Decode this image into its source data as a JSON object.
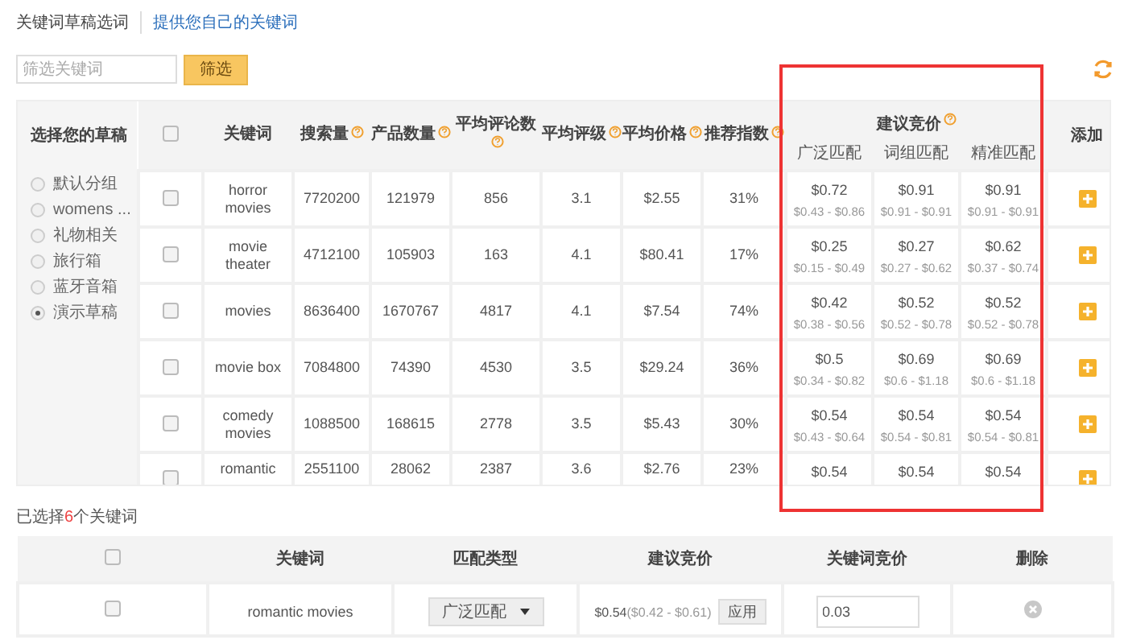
{
  "tabs": [
    {
      "label": "关键词草稿选词",
      "selected": true
    },
    {
      "label": "提供您自己的关键词",
      "selected": false
    }
  ],
  "filter": {
    "placeholder": "筛选关键词",
    "button": "筛选"
  },
  "drafts": {
    "title": "选择您的草稿",
    "items": [
      {
        "label": "默认分组",
        "selected": false
      },
      {
        "label": "womens ...",
        "selected": false
      },
      {
        "label": "礼物相关",
        "selected": false
      },
      {
        "label": "旅行箱",
        "selected": false
      },
      {
        "label": "蓝牙音箱",
        "selected": false
      },
      {
        "label": "演示草稿",
        "selected": true
      }
    ]
  },
  "keyword_table": {
    "select_all": false,
    "columns": [
      {
        "label": "关键词",
        "help": false
      },
      {
        "label": "搜索量",
        "help": true
      },
      {
        "label": "产品数量",
        "help": true
      },
      {
        "label": "平均评论数",
        "help": true
      },
      {
        "label": "平均评级",
        "help": true
      },
      {
        "label": "平均价格",
        "help": true
      },
      {
        "label": "推荐指数",
        "help": true
      }
    ],
    "bid_group": {
      "label": "建议竞价",
      "help": true,
      "columns": [
        "广泛匹配",
        "词组匹配",
        "精准匹配"
      ]
    },
    "add_column": "添加",
    "rows": [
      {
        "checked": false,
        "cells": [
          "horror movies",
          "7720200",
          "121979",
          "856",
          "3.1",
          "$2.55",
          "31%"
        ],
        "bids": [
          {
            "bid": "$0.72",
            "range": "$0.43 - $0.86"
          },
          {
            "bid": "$0.91",
            "range": "$0.91 - $0.91"
          },
          {
            "bid": "$0.91",
            "range": "$0.91 - $0.91"
          }
        ]
      },
      {
        "checked": false,
        "cells": [
          "movie theater",
          "4712100",
          "105903",
          "163",
          "4.1",
          "$80.41",
          "17%"
        ],
        "bids": [
          {
            "bid": "$0.25",
            "range": "$0.15 - $0.49"
          },
          {
            "bid": "$0.27",
            "range": "$0.27 - $0.62"
          },
          {
            "bid": "$0.62",
            "range": "$0.37 - $0.74"
          }
        ]
      },
      {
        "checked": false,
        "cells": [
          "movies",
          "8636400",
          "1670767",
          "4817",
          "4.1",
          "$7.54",
          "74%"
        ],
        "bids": [
          {
            "bid": "$0.42",
            "range": "$0.38 - $0.56"
          },
          {
            "bid": "$0.52",
            "range": "$0.52 - $0.78"
          },
          {
            "bid": "$0.52",
            "range": "$0.52 - $0.78"
          }
        ]
      },
      {
        "checked": false,
        "cells": [
          "movie box",
          "7084800",
          "74390",
          "4530",
          "3.5",
          "$29.24",
          "36%"
        ],
        "bids": [
          {
            "bid": "$0.5",
            "range": "$0.34 - $0.82"
          },
          {
            "bid": "$0.69",
            "range": "$0.6 - $1.18"
          },
          {
            "bid": "$0.69",
            "range": "$0.6 - $1.18"
          }
        ]
      },
      {
        "checked": false,
        "cells": [
          "comedy movies",
          "1088500",
          "168615",
          "2778",
          "3.5",
          "$5.43",
          "30%"
        ],
        "bids": [
          {
            "bid": "$0.54",
            "range": "$0.43 - $0.64"
          },
          {
            "bid": "$0.54",
            "range": "$0.54 - $0.81"
          },
          {
            "bid": "$0.54",
            "range": "$0.54 - $0.81"
          }
        ]
      },
      {
        "checked": false,
        "cells": [
          "romantic",
          "2551100",
          "28062",
          "2387",
          "3.6",
          "$2.76",
          "23%"
        ],
        "bids": [
          {
            "bid": "$0.54"
          },
          {
            "bid": "$0.54"
          },
          {
            "bid": "$0.54"
          }
        ]
      }
    ]
  },
  "annotation": {
    "kind": "highlight-frame"
  },
  "selected_summary": {
    "prefix": "已选择",
    "count": "6",
    "suffix": "个关键词"
  },
  "selected_table": {
    "select_all": false,
    "columns": [
      "关键词",
      "匹配类型",
      "建议竞价",
      "关键词竞价",
      "删除"
    ],
    "rows": [
      {
        "checked": false,
        "keyword": "romantic movies",
        "match_type": "广泛匹配",
        "suggested_bid": "$0.54",
        "bid_range": "($0.42 - $0.61)",
        "apply": "应用",
        "bid_value": "0.03"
      }
    ]
  }
}
